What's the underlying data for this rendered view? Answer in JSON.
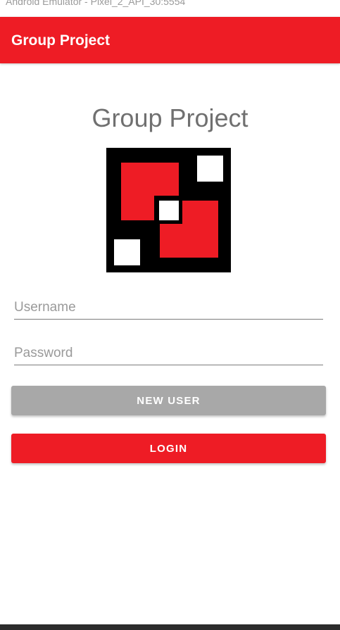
{
  "window": {
    "title": "Android Emulator - Pixel_2_API_30:5554"
  },
  "app_bar": {
    "title": "Group Project"
  },
  "main": {
    "title": "Group Project",
    "username": {
      "value": "",
      "placeholder": "Username"
    },
    "password": {
      "value": "",
      "placeholder": "Password"
    },
    "new_user_label": "NEW USER",
    "login_label": "LOGIN"
  },
  "colors": {
    "accent": "#ee1c25",
    "secondary_button": "#a8a8a8",
    "title_text": "#707070"
  }
}
